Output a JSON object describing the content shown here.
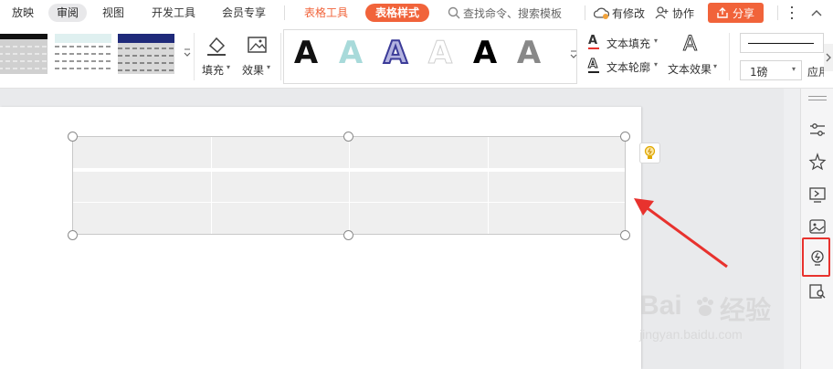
{
  "menubar": {
    "items": [
      "放映",
      "审阅",
      "视图",
      "开发工具",
      "会员专享",
      "表格工具",
      "表格样式"
    ],
    "search_placeholder": "查找命令、搜索模板",
    "modified_label": "有修改",
    "collab_label": "协作",
    "share_label": "分享"
  },
  "ribbon": {
    "fill_label": "填充",
    "effect_label": "效果",
    "wordart_letter": "A",
    "text_fill_label": "文本填充",
    "text_outline_label": "文本轮廓",
    "text_effect_label": "文本效果",
    "line_weight_value": "1磅",
    "apply_label": "应用"
  },
  "watermark": {
    "brand": "Bai",
    "brand_tail": "经验",
    "url": "jingyan.baidu.com"
  },
  "colors": {
    "accent_orange": "#f1633a",
    "annotation_red": "#e8322e",
    "highlight_box": "#e8322e"
  },
  "icons": [
    "paint-bucket-icon",
    "image-effect-icon",
    "search-icon",
    "cloud-sync-icon",
    "user-add-icon",
    "share-icon",
    "more-icon",
    "settings-sliders-icon",
    "star-sparkle-icon",
    "screen-switch-icon",
    "photo-icon",
    "idea-bulb-icon",
    "book-search-icon"
  ]
}
